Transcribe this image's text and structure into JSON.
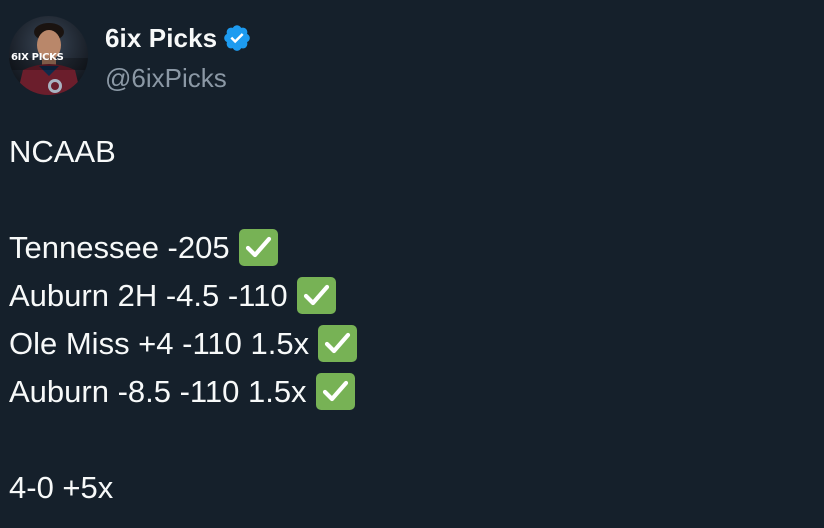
{
  "author": {
    "display_name": "6ix Picks",
    "handle": "@6ixPicks",
    "avatar_text": "6IX PICKS",
    "verified": true,
    "verified_color": "#1d9bf0"
  },
  "tweet": {
    "league": "NCAAB",
    "picks": [
      {
        "text": "Tennessee -205",
        "result_icon": "check-mark-button-icon"
      },
      {
        "text": "Auburn 2H -4.5 -110",
        "result_icon": "check-mark-button-icon"
      },
      {
        "text": "Ole Miss +4 -110 1.5x",
        "result_icon": "check-mark-button-icon"
      },
      {
        "text": "Auburn -8.5 -110 1.5x",
        "result_icon": "check-mark-button-icon"
      }
    ],
    "summary": "4-0 +5x"
  },
  "colors": {
    "background": "#15202b",
    "text": "#f7f9f9",
    "secondary_text": "#8b98a5",
    "check_green": "#77b255"
  }
}
